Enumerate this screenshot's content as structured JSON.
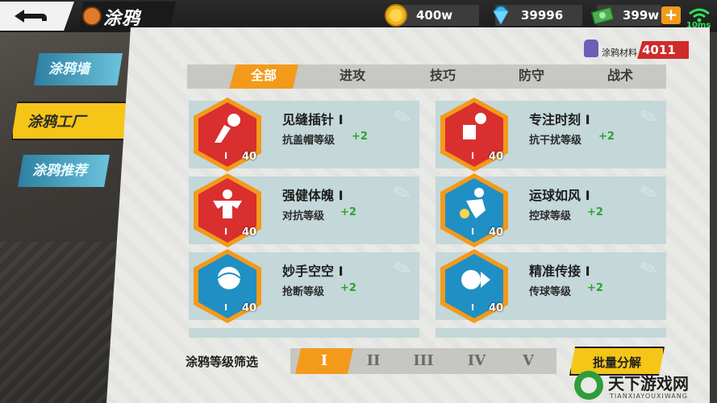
{
  "header": {
    "title": "涂鸦",
    "gold": "400w",
    "diamonds": "39996",
    "cash": "399w",
    "plus": "+",
    "ping": "10ms"
  },
  "sidebar": {
    "items": [
      {
        "label": "涂鸦墙"
      },
      {
        "label": "涂鸦工厂"
      },
      {
        "label": "涂鸦推荐"
      }
    ]
  },
  "material": {
    "label": "涂鸦材料",
    "count": "4011"
  },
  "tabs": [
    {
      "label": "全部"
    },
    {
      "label": "进攻"
    },
    {
      "label": "技巧"
    },
    {
      "label": "防守"
    },
    {
      "label": "战术"
    }
  ],
  "cards": [
    {
      "name": "见缝插针 Ⅰ",
      "stat": "抗盖帽等级",
      "bonus": "+2",
      "tier": "I",
      "level": "40",
      "icon": "block-icon",
      "color": "red"
    },
    {
      "name": "专注时刻 Ⅰ",
      "stat": "抗干扰等级",
      "bonus": "+2",
      "tier": "I",
      "level": "40",
      "icon": "focus-icon",
      "color": "red"
    },
    {
      "name": "强健体魄 Ⅰ",
      "stat": "对抗等级",
      "bonus": "+2",
      "tier": "I",
      "level": "40",
      "icon": "muscle-icon",
      "color": "red"
    },
    {
      "name": "运球如风 Ⅰ",
      "stat": "控球等级",
      "bonus": "+2",
      "tier": "I",
      "level": "40",
      "icon": "dribble-icon",
      "color": "blue"
    },
    {
      "name": "妙手空空 Ⅰ",
      "stat": "抢断等级",
      "bonus": "+2",
      "tier": "I",
      "level": "40",
      "icon": "steal-icon",
      "color": "blue"
    },
    {
      "name": "精准传接 Ⅰ",
      "stat": "传球等级",
      "bonus": "+2",
      "tier": "I",
      "level": "40",
      "icon": "pass-icon",
      "color": "blue"
    }
  ],
  "filter": {
    "label": "涂鸦等级筛选",
    "tiers": [
      "I",
      "II",
      "III",
      "IV",
      "V"
    ],
    "batch_button": "批量分解"
  },
  "watermark": {
    "name": "天下游戏网",
    "sub": "TIANXIAYOUXIWANG"
  }
}
